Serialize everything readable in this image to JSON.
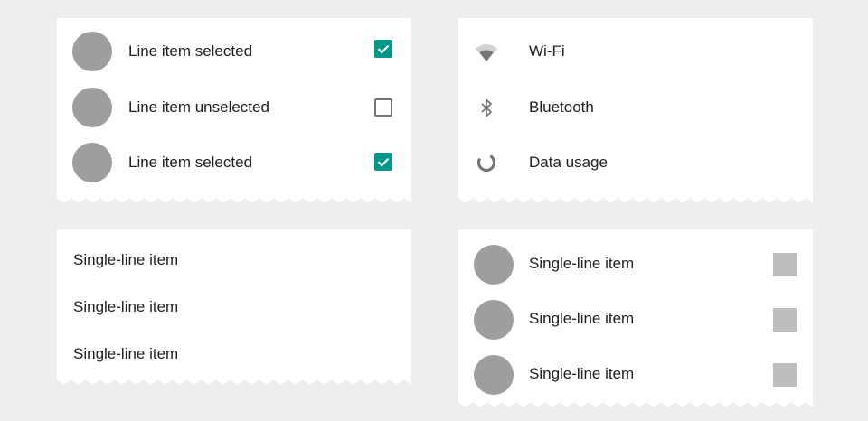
{
  "colors": {
    "background": "#eeeeee",
    "card": "#ffffff",
    "avatar": "#9e9e9e",
    "checkbox_checked": "#009688",
    "checkbox_border": "#757575",
    "placeholder_square": "#bdbdbd",
    "icon": "#757575",
    "text": "#212121"
  },
  "card_avatar_checkbox": {
    "items": [
      {
        "label": "Line item selected",
        "checked": true
      },
      {
        "label": "Line item unselected",
        "checked": false
      },
      {
        "label": "Line item selected",
        "checked": true
      }
    ]
  },
  "card_icons": {
    "items": [
      {
        "label": "Wi-Fi",
        "icon": "wifi-icon"
      },
      {
        "label": "Bluetooth",
        "icon": "bluetooth-icon"
      },
      {
        "label": "Data usage",
        "icon": "data-usage-icon"
      }
    ]
  },
  "card_single_line": {
    "items": [
      {
        "label": "Single-line item"
      },
      {
        "label": "Single-line item"
      },
      {
        "label": "Single-line item"
      }
    ]
  },
  "card_avatar_square": {
    "items": [
      {
        "label": "Single-line item"
      },
      {
        "label": "Single-line item"
      },
      {
        "label": "Single-line item"
      }
    ]
  }
}
